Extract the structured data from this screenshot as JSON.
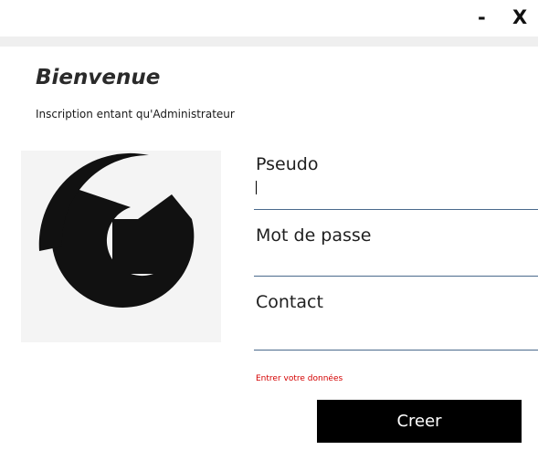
{
  "window": {
    "minimize_label": "-",
    "close_label": "X"
  },
  "header": {
    "title": "Bienvenue",
    "subtitle": "Inscription entant qu'Administrateur"
  },
  "logo": {
    "icon": "g-logo-icon",
    "background_color": "#f4f4f4",
    "mark_color": "#111111"
  },
  "form": {
    "pseudo": {
      "label": "Pseudo",
      "value": ""
    },
    "password": {
      "label": "Mot de passe",
      "value": ""
    },
    "contact": {
      "label": "Contact",
      "value": ""
    },
    "error": "Entrer votre données",
    "submit_label": "Creer"
  },
  "colors": {
    "error": "#d40000",
    "button_bg": "#000000",
    "underline": "#4a6a8c"
  }
}
